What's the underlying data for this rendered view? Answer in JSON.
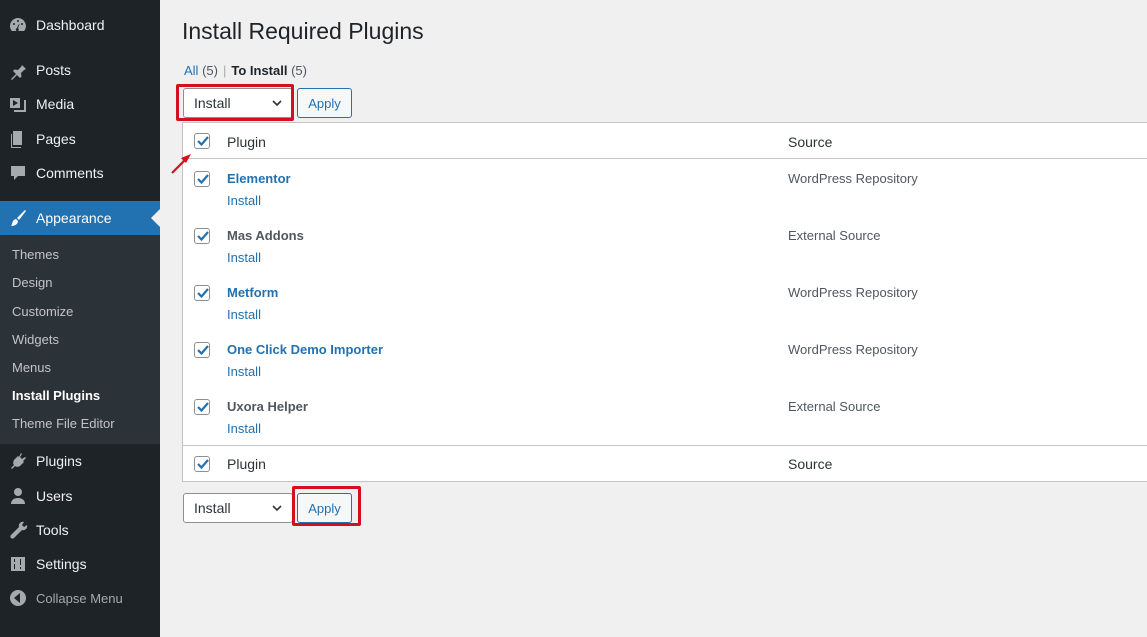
{
  "sidebar": {
    "items": [
      {
        "label": "Dashboard",
        "icon": "dashboard-icon"
      },
      {
        "label": "Posts",
        "icon": "pin-icon"
      },
      {
        "label": "Media",
        "icon": "media-icon"
      },
      {
        "label": "Pages",
        "icon": "pages-icon"
      },
      {
        "label": "Comments",
        "icon": "comment-icon"
      },
      {
        "label": "Appearance",
        "icon": "brush-icon"
      },
      {
        "label": "Plugins",
        "icon": "plugin-icon"
      },
      {
        "label": "Users",
        "icon": "user-icon"
      },
      {
        "label": "Tools",
        "icon": "wrench-icon"
      },
      {
        "label": "Settings",
        "icon": "sliders-icon"
      }
    ],
    "submenu": [
      "Themes",
      "Design",
      "Customize",
      "Widgets",
      "Menus",
      "Install Plugins",
      "Theme File Editor"
    ],
    "collapse_label": "Collapse Menu"
  },
  "page": {
    "title": "Install Required Plugins",
    "filters": {
      "all_label": "All",
      "all_count": "(5)",
      "to_install_label": "To Install",
      "to_install_count": "(5)"
    },
    "bulk_action": {
      "selected": "Install",
      "apply_label": "Apply"
    }
  },
  "table": {
    "columns": {
      "plugin": "Plugin",
      "source": "Source"
    },
    "rows": [
      {
        "name": "Elementor",
        "action": "Install",
        "source": "WordPress Repository",
        "checked": true
      },
      {
        "name": "Mas Addons",
        "action": "Install",
        "source": "External Source",
        "checked": true
      },
      {
        "name": "Metform",
        "action": "Install",
        "source": "WordPress Repository",
        "checked": true
      },
      {
        "name": "One Click Demo Importer",
        "action": "Install",
        "source": "WordPress Repository",
        "checked": true
      },
      {
        "name": "Uxora Helper",
        "action": "Install",
        "source": "External Source",
        "checked": true
      }
    ]
  },
  "colors": {
    "accent": "#2271b1",
    "sidebar_bg": "#1d2327",
    "highlight": "#d40f1e"
  }
}
